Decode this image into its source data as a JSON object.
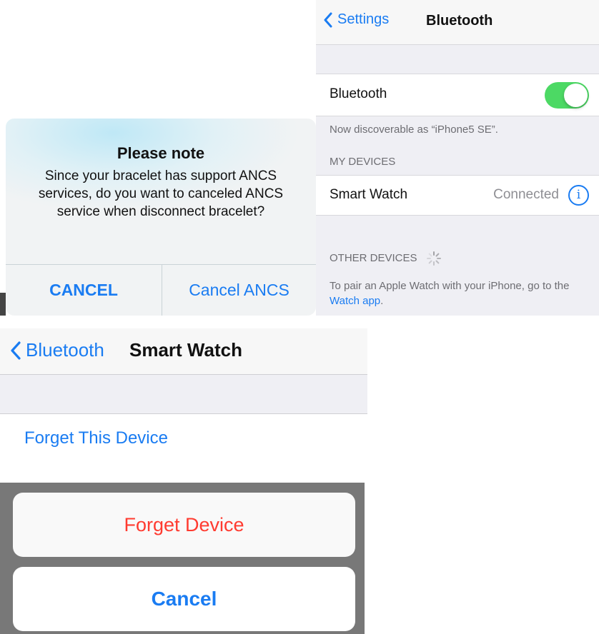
{
  "alert": {
    "title": "Please note",
    "message": "Since your bracelet has support ANCS services, do you want to canceled ANCS service when disconnect bracelet?",
    "cancel_label": "CANCEL",
    "cancel_ancs_label": "Cancel ANCS"
  },
  "bluetooth_settings": {
    "back_label": "Settings",
    "title": "Bluetooth",
    "bluetooth_label": "Bluetooth",
    "bluetooth_enabled": true,
    "discoverable_text": "Now discoverable as “iPhone5 SE”.",
    "my_devices_header": "MY DEVICES",
    "devices": [
      {
        "name": "Smart Watch",
        "status": "Connected"
      }
    ],
    "other_devices_header": "OTHER DEVICES",
    "pair_text": "To pair an Apple Watch with your iPhone, go to the",
    "pair_link": "Watch app",
    "pair_text_end": "."
  },
  "smart_watch": {
    "back_label": "Bluetooth",
    "title": "Smart Watch",
    "forget_label": "Forget This Device"
  },
  "action_sheet": {
    "forget_label": "Forget Device",
    "cancel_label": "Cancel"
  },
  "colors": {
    "accent": "#1a7cf2",
    "destructive": "#ff3b30",
    "toggle_on": "#4cd964"
  }
}
